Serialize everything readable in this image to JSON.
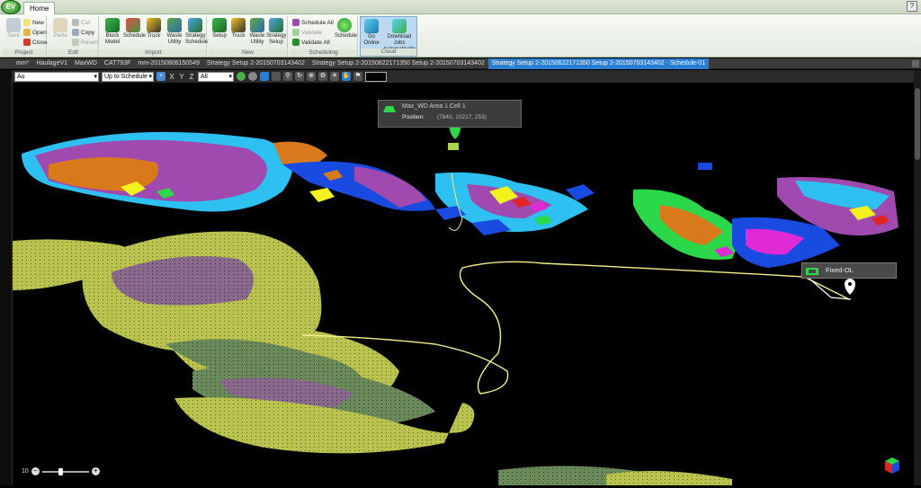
{
  "app": {
    "logo_text": "EV",
    "tab_home": "Home"
  },
  "ribbon": {
    "project": {
      "label": "Project",
      "save": "Save",
      "new": "New",
      "open": "Open",
      "close": "Close"
    },
    "edit": {
      "label": "Edit",
      "paste": "Paste",
      "cut": "Cut",
      "copy": "Copy",
      "revert": "Revert"
    },
    "import": {
      "label": "Import",
      "block_model": "Block Model",
      "schedule": "Schedule",
      "truck": "Truck",
      "waste_utility": "Waste Utility",
      "strategy_schedule": "Strategy Schedule"
    },
    "new": {
      "label": "New",
      "setup": "Setup",
      "truck": "Truck",
      "waste_utility": "Waste Utility",
      "strategy_setup": "Strategy Setup"
    },
    "scheduling": {
      "label": "Scheduling",
      "schedule_all": "Schedule All",
      "validate": "Validate",
      "validate_all": "Validate All",
      "schedule": "Schedule"
    },
    "cloud": {
      "label": "Cloud",
      "go_online": "Go Online",
      "download_jobs": "Download Jobs Automatically"
    }
  },
  "doc_tabs": [
    "mm*",
    "HaulageV1",
    "MaxWD",
    "CAT793F",
    "mm-20150806150549",
    "Strategy Setup 2-20150703143402",
    "Strategy Setup 2-20150622171350 Setup 2-20150703143402",
    "Strategy Setup 2-20150622171350 Setup 2-20150703143402 - Schedule-01"
  ],
  "active_doc_tab": 7,
  "toolbar": {
    "attribute": "Au",
    "period_mode": "Up to Schedule",
    "axis_x": "X",
    "axis_y": "Y",
    "axis_z": "Z",
    "filter": "All"
  },
  "tooltip": {
    "title": "Max_WD Area 1 Cell 1",
    "position_label": "Position:",
    "position_value": "(7843, 10217, 253)"
  },
  "fixed_label": {
    "text": "Fixed-OL"
  },
  "zoom": {
    "value": "10",
    "minus": "−",
    "plus": "+"
  },
  "colors": {
    "accent_tab": "#2a7fd2",
    "haul_road": "#f5f08a",
    "pit_green": "#b9c34e",
    "pit_purple": "#8a6a8c",
    "block_blue": "#1a4be0",
    "block_cyan": "#2ec0f0",
    "block_purple": "#a04ab0",
    "block_orange": "#d87a1c",
    "block_yellow": "#f2f21e",
    "block_green": "#2ad84a",
    "block_red": "#e02424",
    "block_magenta": "#e02ad8"
  }
}
